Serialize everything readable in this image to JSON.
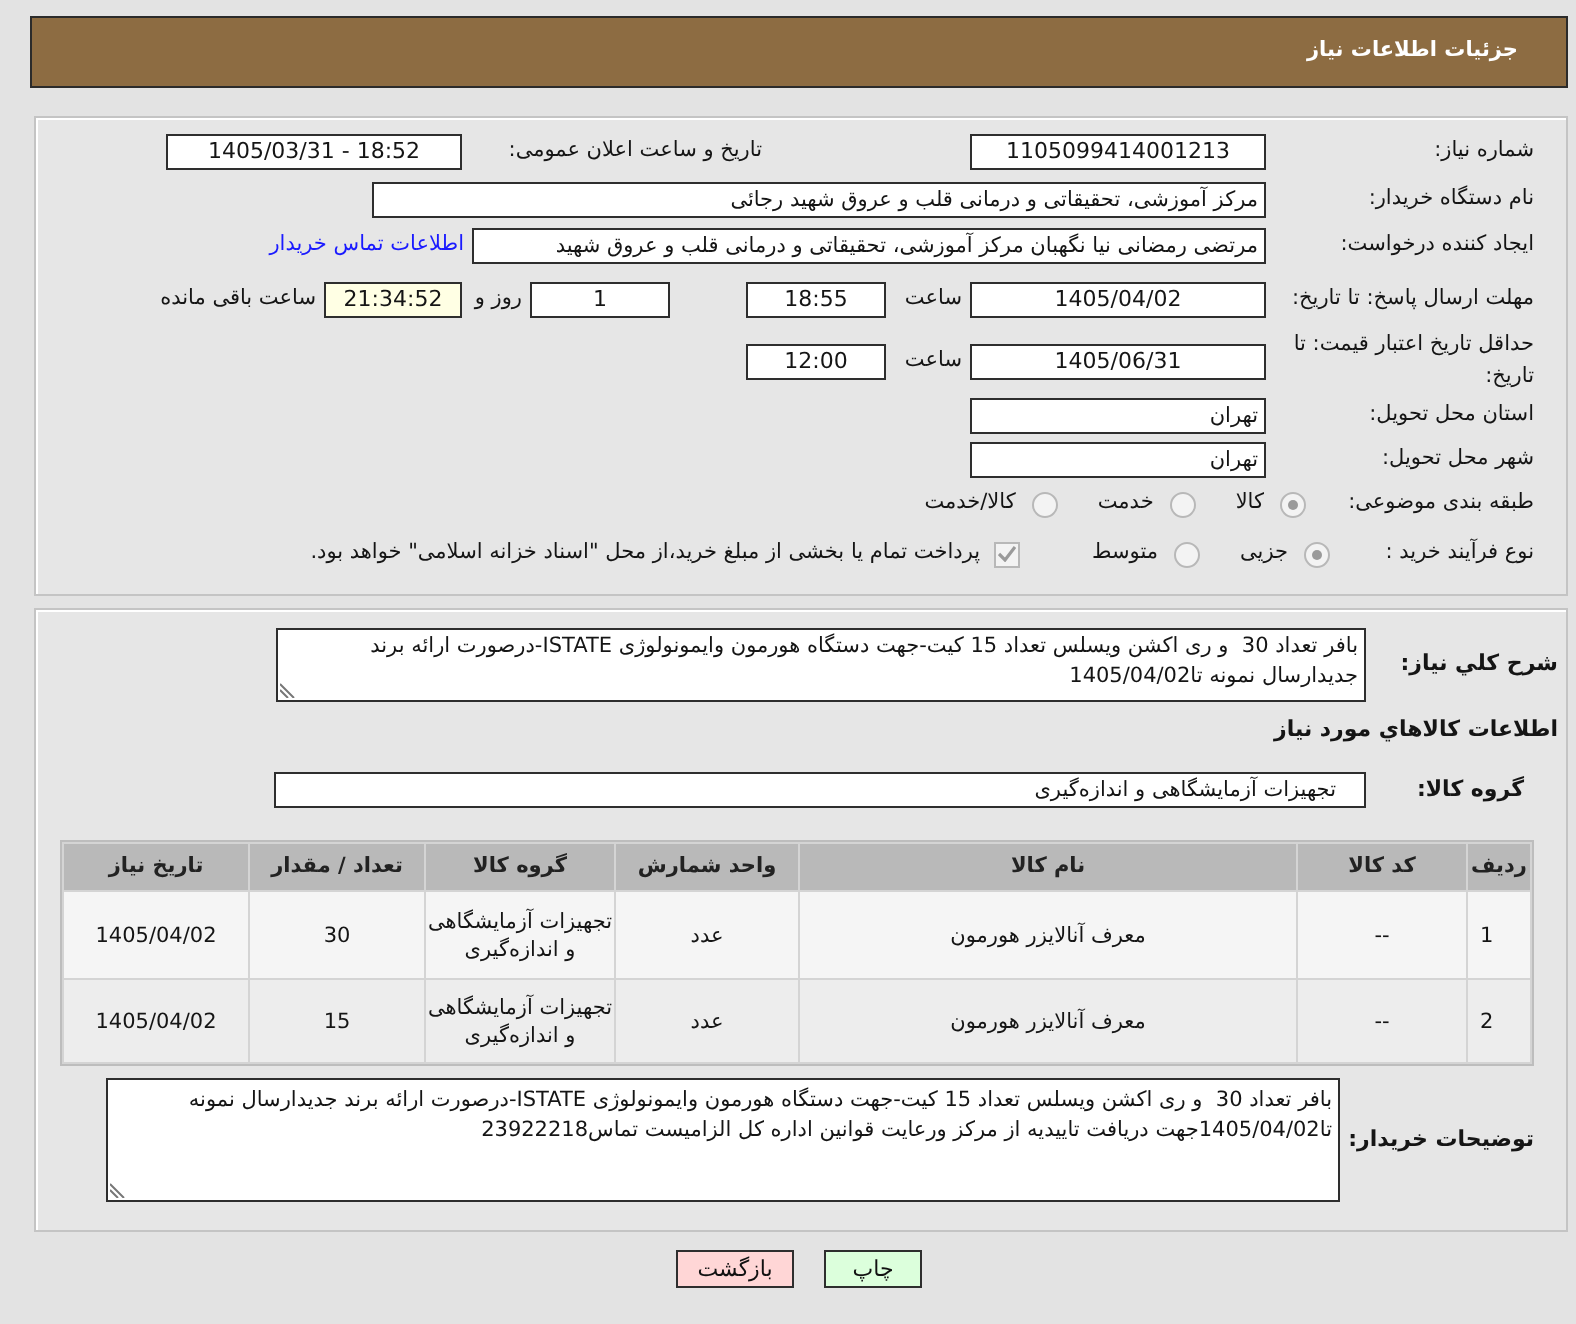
{
  "header": {
    "title": "جزئیات اطلاعات نیاز"
  },
  "details": {
    "need_number": {
      "label": "شماره نیاز:",
      "value": "1105099414001213"
    },
    "announcement": {
      "label": "تاریخ و ساعت اعلان عمومی:",
      "value": "1405/03/31 - 18:52"
    },
    "buyer_org": {
      "label": "نام دستگاه خریدار:",
      "value": "مرکز آموزشی، تحقیقاتی و درمانی قلب و عروق شهید رجائی"
    },
    "requester": {
      "label": "ایجاد کننده درخواست:",
      "value": "مرتضی رمضانی نیا نگهبان مرکز آموزشی، تحقیقاتی و درمانی قلب و عروق شهید",
      "contact_link": "اطلاعات تماس خریدار"
    },
    "reply_deadline": {
      "label": "مهلت ارسال پاسخ: تا تاریخ:",
      "date": "1405/04/02",
      "time_label": "ساعت",
      "time": "18:55",
      "days": "1",
      "days_label": "روز و",
      "remaining": "21:34:52",
      "remaining_label": "ساعت باقی مانده"
    },
    "price_validity": {
      "label": "حداقل تاریخ اعتبار قیمت: تا تاریخ:",
      "date": "1405/06/31",
      "time_label": "ساعت",
      "time": "12:00"
    },
    "province": {
      "label": "استان محل تحویل:",
      "value": "تهران"
    },
    "city": {
      "label": "شهر محل تحویل:",
      "value": "تهران"
    },
    "category": {
      "label": "طبقه بندی موضوعی:",
      "options": [
        {
          "label": "کالا",
          "selected": true
        },
        {
          "label": "خدمت",
          "selected": false
        },
        {
          "label": "کالا/خدمت",
          "selected": false
        }
      ]
    },
    "purchase_process": {
      "label": "نوع فرآیند خرید :",
      "options": [
        {
          "label": "جزیی",
          "selected": true
        },
        {
          "label": "متوسط",
          "selected": false
        }
      ],
      "treasury_payment": {
        "label": "پرداخت تمام یا بخشی از مبلغ خرید،از محل \"اسناد خزانه اسلامی\" خواهد بود.",
        "checked": true
      }
    }
  },
  "description": {
    "label": "شرح کلي نياز:",
    "text": "بافر تعداد 30  و ری اکشن ویسلس تعداد 15 کیت-جهت دستگاه هورمون وایمونولوژی ISTATE-درصورت ارائه برند جدیدارسال نمونه تا1405/04/02"
  },
  "items": {
    "title": "اطلاعات کالاهاي مورد نياز",
    "group_label": "گروه کالا:",
    "group_value": "تجهیزات آزمایشگاهی و اندازه‌گیری",
    "table": {
      "columns": [
        "ردیف",
        "کد کالا",
        "نام کالا",
        "واحد شمارش",
        "گروه کالا",
        "تعداد / مقدار",
        "تاریخ نیاز"
      ],
      "rows": [
        [
          "1",
          "--",
          "معرف آنالایزر هورمون",
          "عدد",
          "تجهیزات آزمایشگاهی و اندازه‌گیری",
          "30",
          "1405/04/02"
        ],
        [
          "2",
          "--",
          "معرف آنالایزر هورمون",
          "عدد",
          "تجهیزات آزمایشگاهی و اندازه‌گیری",
          "15",
          "1405/04/02"
        ]
      ]
    }
  },
  "buyer_notes": {
    "label": "توضیحات خریدار:",
    "text": "بافر تعداد 30  و ری اکشن ویسلس تعداد 15 کیت-جهت دستگاه هورمون وایمونولوژی ISTATE-درصورت ارائه برند جدیدارسال نمونه تا1405/04/02جهت دریافت تاییدیه از مرکز ورعایت قوانین اداره کل الزامیست تماس23922218"
  },
  "buttons": [
    {
      "label": "چاپ",
      "kind": "print"
    },
    {
      "label": "بازگشت",
      "kind": "back"
    }
  ]
}
